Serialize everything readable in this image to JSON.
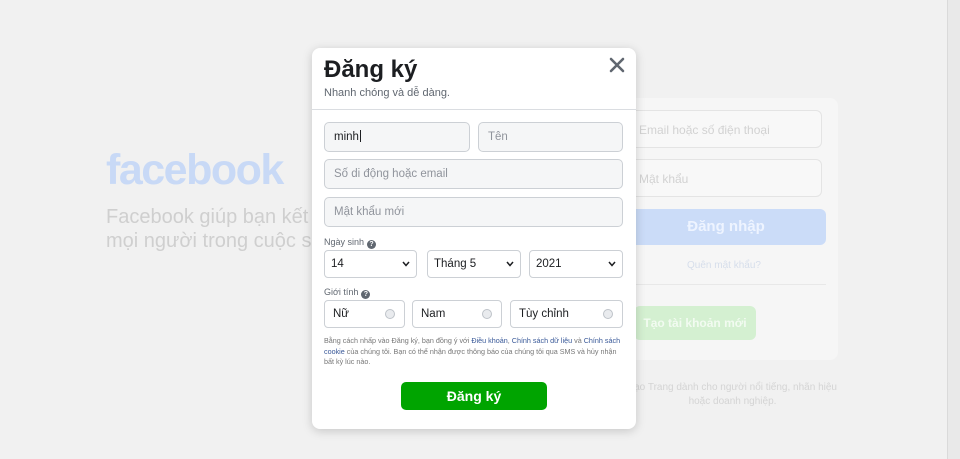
{
  "background": {
    "logo": "facebook",
    "tagline": "Facebook giúp bạn kết nối và chia sẻ với mọi người trong cuộc sống của bạn.",
    "login": {
      "phone_placeholder": "Email hoặc số điện thoại",
      "password_placeholder": "Mật khẩu",
      "login_label": "Đăng nhập",
      "forgot_label": "Quên mật khẩu?",
      "create_label": "Tạo tài khoản mới"
    },
    "note": "Tạo Trang dành cho người nổi tiếng, nhãn hiệu hoặc doanh nghiệp."
  },
  "modal": {
    "title": "Đăng ký",
    "subtitle": "Nhanh chóng và dễ dàng.",
    "first_name_value": "minh",
    "last_name_placeholder": "Tên",
    "contact_placeholder": "Số di động hoặc email",
    "password_placeholder": "Mật khẩu mới",
    "birthday_label": "Ngày sinh",
    "birthday": {
      "day": "14",
      "month": "Tháng 5",
      "year": "2021"
    },
    "gender_label": "Giới tính",
    "genders": [
      "Nữ",
      "Nam",
      "Tùy chỉnh"
    ],
    "terms": {
      "p1": "Bằng cách nhấp vào Đăng ký, bạn đồng ý với ",
      "link_terms": "Điều khoản",
      "p2": ", ",
      "link_data": "Chính sách dữ liệu",
      "p3": " và ",
      "link_cookie": "Chính sách cookie",
      "p4": " của chúng tôi. Bạn có thể nhận được thông báo của chúng tôi qua SMS và hủy nhận bất kỳ lúc nào."
    },
    "signup_label": "Đăng ký"
  },
  "colors": {
    "signup_green": "#00a400",
    "link_blue": "#385898",
    "logo_faded_blue": "#c8d9f6"
  }
}
